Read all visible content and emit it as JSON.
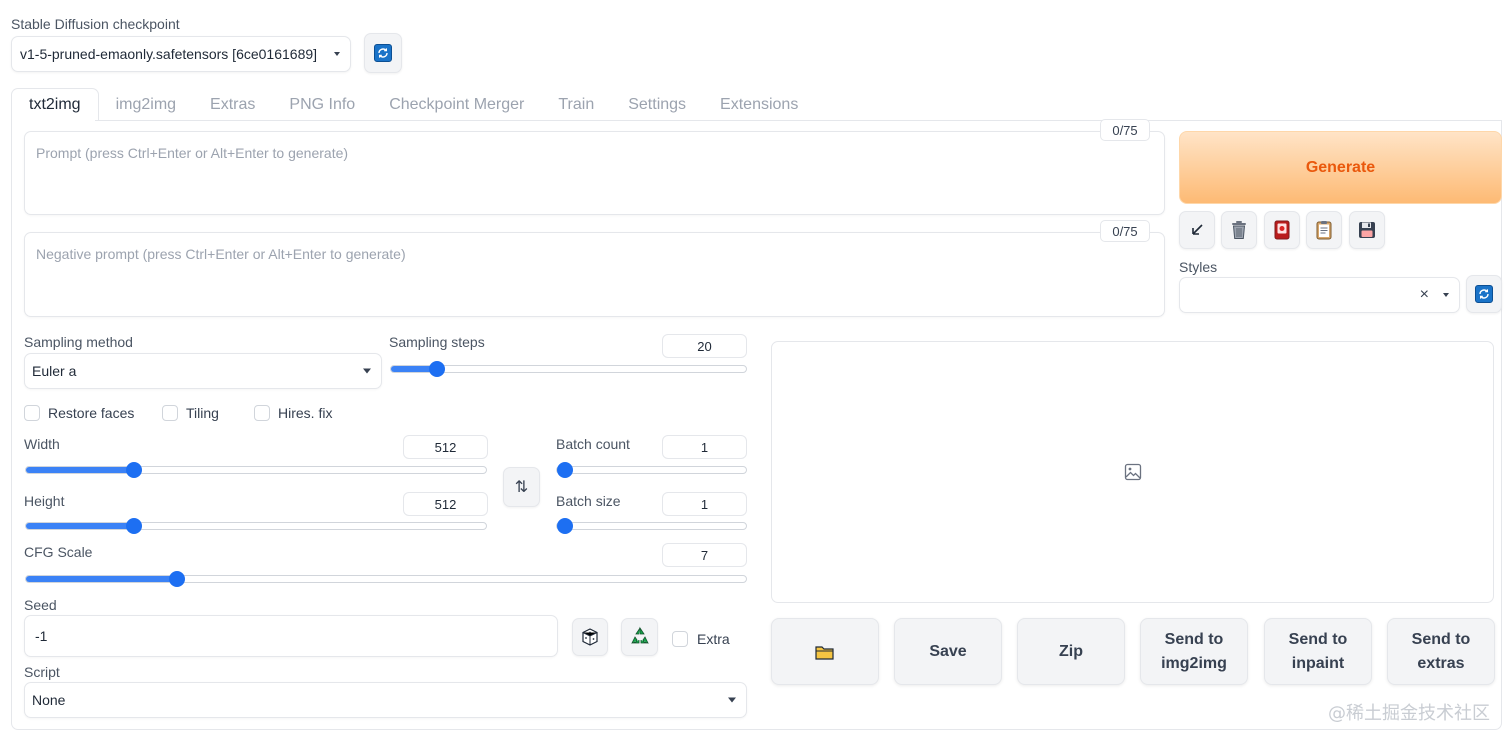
{
  "checkpoint": {
    "label": "Stable Diffusion checkpoint",
    "value": "v1-5-pruned-emaonly.safetensors [6ce0161689]"
  },
  "tabs": [
    {
      "label": "txt2img",
      "active": true
    },
    {
      "label": "img2img"
    },
    {
      "label": "Extras"
    },
    {
      "label": "PNG Info"
    },
    {
      "label": "Checkpoint Merger"
    },
    {
      "label": "Train"
    },
    {
      "label": "Settings"
    },
    {
      "label": "Extensions"
    }
  ],
  "prompt": {
    "placeholder": "Prompt (press Ctrl+Enter or Alt+Enter to generate)",
    "counter": "0/75"
  },
  "negative_prompt": {
    "placeholder": "Negative prompt (press Ctrl+Enter or Alt+Enter to generate)",
    "counter": "0/75"
  },
  "generate_label": "Generate",
  "tool_icons": [
    "arrow-icon",
    "trash-icon",
    "card-icon",
    "clipboard-icon",
    "floppy-disk-icon"
  ],
  "styles": {
    "label": "Styles",
    "clear": "×"
  },
  "sampling": {
    "method_label": "Sampling method",
    "method_value": "Euler a",
    "steps_label": "Sampling steps",
    "steps_value": "20",
    "steps_fraction": 0.13
  },
  "checks": {
    "restore_faces": "Restore faces",
    "tiling": "Tiling",
    "hires_fix": "Hires. fix"
  },
  "width": {
    "label": "Width",
    "value": "512",
    "fraction": 0.235
  },
  "height": {
    "label": "Height",
    "value": "512",
    "fraction": 0.235
  },
  "swap_label": "⇅",
  "batch_count": {
    "label": "Batch count",
    "value": "1",
    "fraction": 0
  },
  "batch_size": {
    "label": "Batch size",
    "value": "1",
    "fraction": 0
  },
  "cfg": {
    "label": "CFG Scale",
    "value": "7",
    "fraction": 0.21
  },
  "seed": {
    "label": "Seed",
    "value": "-1",
    "extra_label": "Extra"
  },
  "script": {
    "label": "Script",
    "value": "None"
  },
  "output_buttons": {
    "folder": "",
    "save": "Save",
    "zip": "Zip",
    "send_img2img": "Send to\nimg2img",
    "send_inpaint": "Send to\ninpaint",
    "send_extras": "Send to\nextras"
  },
  "watermark": "@稀土掘金技术社区"
}
